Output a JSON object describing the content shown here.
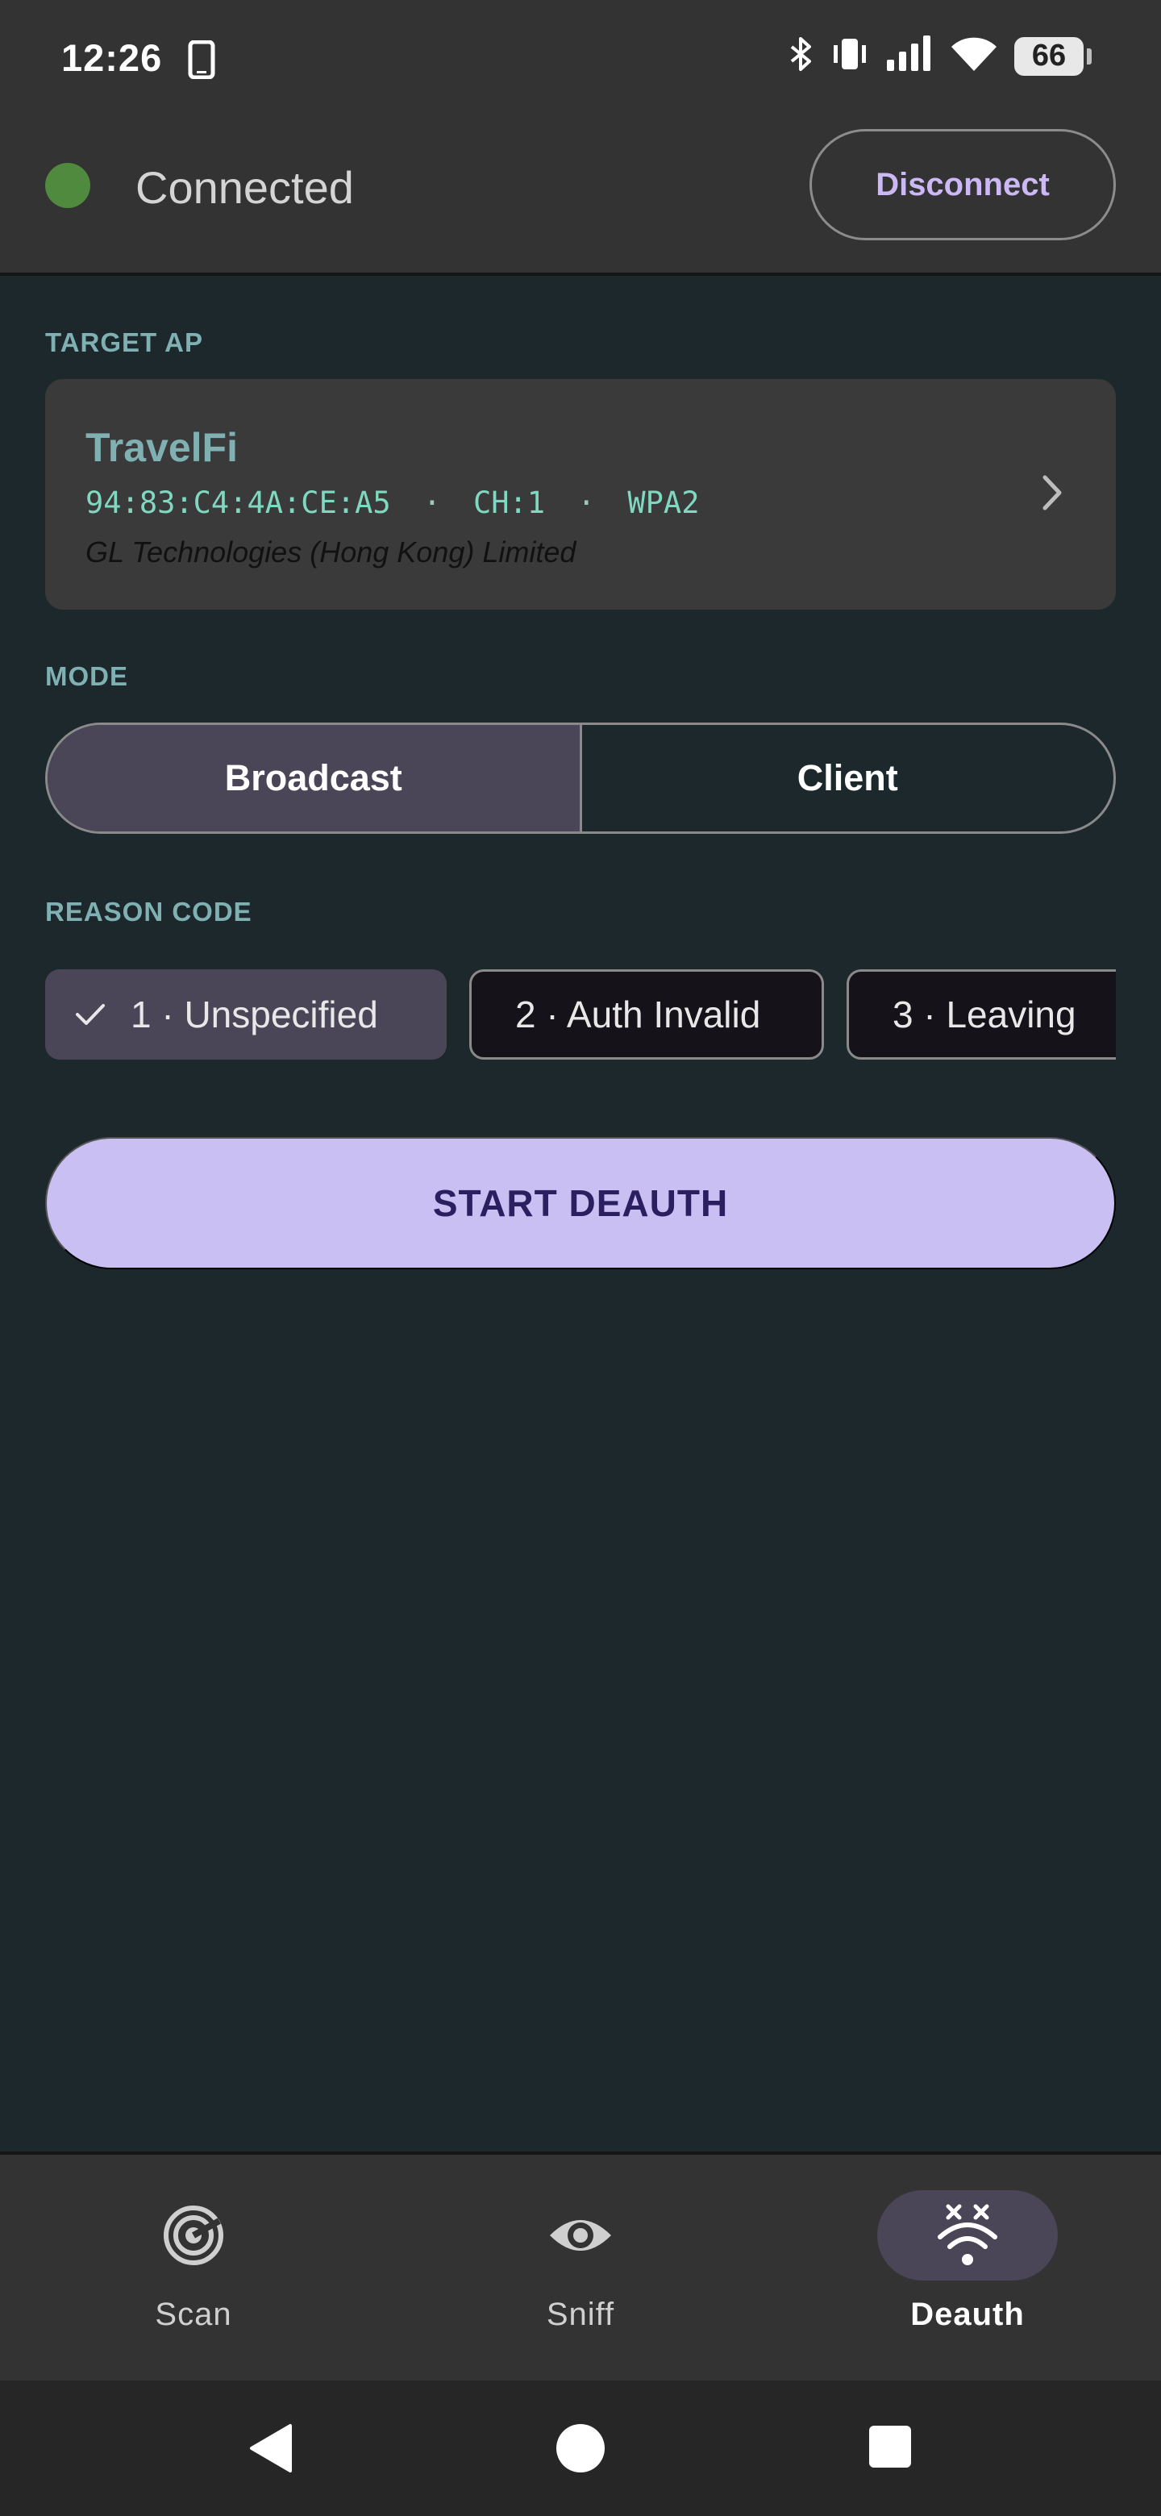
{
  "status_bar": {
    "time": "12:26",
    "battery": "66"
  },
  "connection": {
    "status": "Connected",
    "status_color": "#4f8a3e",
    "disconnect_label": "Disconnect"
  },
  "target_ap": {
    "section_label": "TARGET AP",
    "ssid": "TravelFi",
    "bssid": "94:83:C4:4A:CE:A5",
    "channel": "CH:1",
    "security": "WPA2",
    "separator": "·",
    "vendor": "GL Technologies (Hong Kong) Limited"
  },
  "mode": {
    "section_label": "MODE",
    "options": [
      "Broadcast",
      "Client"
    ],
    "selected": "Broadcast"
  },
  "reason_code": {
    "section_label": "REASON CODE",
    "chips": [
      "1 · Unspecified",
      "2 · Auth Invalid",
      "3 · Leaving"
    ],
    "selected": "1 · Unspecified"
  },
  "action": {
    "start_label": "START DEAUTH"
  },
  "bottom_nav": {
    "items": [
      {
        "label": "Scan",
        "icon": "radar-icon"
      },
      {
        "label": "Sniff",
        "icon": "eye-icon"
      },
      {
        "label": "Deauth",
        "icon": "wifi-off-icon"
      }
    ],
    "active": "Deauth"
  },
  "colors": {
    "background": "#1c282c",
    "surface": "#333333",
    "accent": "#c9bff2",
    "teal_label": "#7fb0b2"
  }
}
